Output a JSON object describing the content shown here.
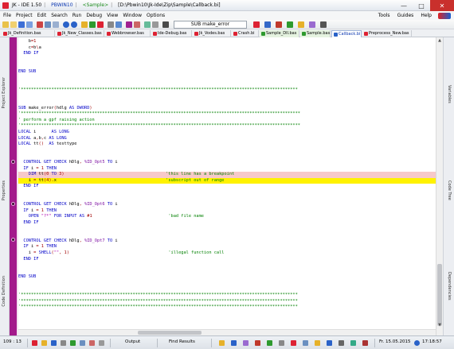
{
  "window": {
    "app": "JK - IDE 1.50",
    "compiler": "PBWIN10",
    "sample_tag": "<Sample>",
    "path": "[D:\\Pbwin10\\Jk-Ide\\Zip\\Sample\\Callback.bi]",
    "controls": [
      "minimize-icon",
      "maximize-icon",
      "close-icon"
    ]
  },
  "menu": {
    "left": [
      "File",
      "Project",
      "Edit",
      "Search",
      "Run",
      "Debug",
      "View",
      "Window",
      "Options"
    ],
    "right": [
      "Tools",
      "Guides",
      "Help"
    ]
  },
  "toolbar": {
    "procedure_combo": "SUB make_error"
  },
  "tabs": [
    "Jk_Definition.bas",
    "Jk_New_Classes.bas",
    "Webbrowser.bas",
    "Ide-Debug.bas",
    "Jk_Vodes.bas",
    "Crash.bi",
    "Sample_Dll.bas",
    "Sample.bas",
    "Callback.bi",
    "Preprocess_New.bas"
  ],
  "active_tab_index": 8,
  "left_panels": [
    "Project Explorer",
    "Properties",
    "Code Definition"
  ],
  "right_panels": [
    "Variables",
    "Code Tree",
    "Dependencies"
  ],
  "code": {
    "lines": [
      {
        "t": "    b=1"
      },
      {
        "t": "    c=b\\a"
      },
      {
        "t": "  END IF"
      },
      {
        "t": ""
      },
      {
        "t": ""
      },
      {
        "t": "END SUB"
      },
      {
        "t": ""
      },
      {
        "t": ""
      },
      {
        "t": "'*************************************************************************************************************"
      },
      {
        "t": ""
      },
      {
        "t": ""
      },
      {
        "t": "SUB make_error(hdlg AS DWORD)"
      },
      {
        "t": "'**************************************************************************************************************"
      },
      {
        "t": "' perform a gpf raising action"
      },
      {
        "t": "'**************************************************************************************************************"
      },
      {
        "t": "LOCAL i      AS LONG"
      },
      {
        "t": "LOCAL a,b,c AS LONG"
      },
      {
        "t": "LOCAL tt()  AS testtype"
      },
      {
        "t": ""
      },
      {
        "t": ""
      },
      {
        "t": "  CONTROL GET CHECK hDlg, %ID_Opt5 TO i"
      },
      {
        "t": "  IF i = 1 THEN"
      },
      {
        "t": "    DIM tt(0 TO 3)                                        'this line has a breakpoint",
        "k": "bp"
      },
      {
        "t": "    i = tt(4).x                                           'subscript out of range",
        "k": "cur"
      },
      {
        "t": "  END IF"
      },
      {
        "t": ""
      },
      {
        "t": ""
      },
      {
        "t": "  CONTROL GET CHECK hDlg, %ID_Opt6 TO i"
      },
      {
        "t": "  IF i = 1 THEN"
      },
      {
        "t": "    OPEN \"?*\" FOR INPUT AS #1                              'bad file name"
      },
      {
        "t": "  END IF"
      },
      {
        "t": ""
      },
      {
        "t": ""
      },
      {
        "t": "  CONTROL GET CHECK hDlg, %ID_Opt7 TO i"
      },
      {
        "t": "  IF i = 1 THEN"
      },
      {
        "t": "    i = SHELL(\"\", 1)                                       'illegal function call"
      },
      {
        "t": "  END IF"
      },
      {
        "t": ""
      },
      {
        "t": ""
      },
      {
        "t": "END SUB"
      },
      {
        "t": ""
      },
      {
        "t": ""
      },
      {
        "t": "'*************************************************************************************************************"
      },
      {
        "t": "'*************************************************************************************************************"
      },
      {
        "t": "'*************************************************************************************************************"
      }
    ],
    "breakpoint_rows": [
      20,
      27,
      33
    ]
  },
  "status": {
    "position": "109 : 13",
    "output_label": "Output",
    "find_label": "Find Results",
    "date": "Fr. 15.05.2015",
    "time": "17:18:57"
  },
  "colors": {
    "gutter": "#a31a8b",
    "breakpoint_line": "#f7c9c9",
    "current_line": "#fff200",
    "keyword": "#0000c8",
    "comment": "#008000"
  }
}
